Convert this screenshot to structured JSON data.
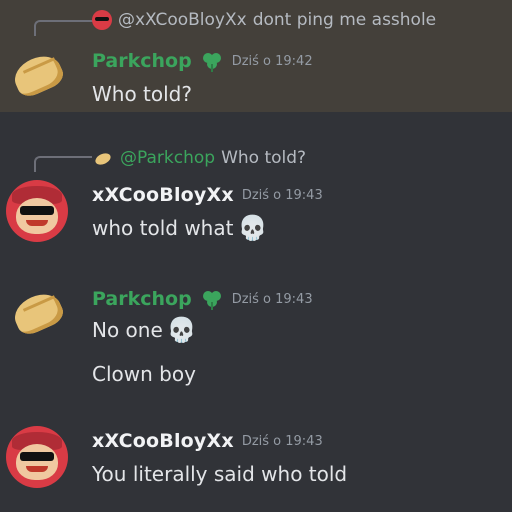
{
  "messages": [
    {
      "reply": {
        "author": "@xXCooBloyXx",
        "text": "dont ping me asshole"
      },
      "author": "Parkchop",
      "timestamp": "Dziś o 19:42",
      "lines": [
        "Who told?"
      ],
      "highlighted": true
    },
    {
      "reply": {
        "author": "@Parkchop",
        "text": "Who told?"
      },
      "author": "xXCooBloyXx",
      "timestamp": "Dziś o 19:43",
      "lines": [
        "who told what"
      ]
    },
    {
      "author": "Parkchop",
      "timestamp": "Dziś o 19:43",
      "lines": [
        "No one",
        "Clown boy"
      ]
    },
    {
      "author": "xXCooBloyXx",
      "timestamp": "Dziś o 19:43",
      "lines": [
        "You literally said who told"
      ]
    }
  ],
  "emoji": {
    "skull": "💀",
    "skull_icon": "skull-icon"
  },
  "colors": {
    "background": "#313338",
    "highlight": "#44403a",
    "green_name": "#3ba55d",
    "clown_red": "#d93b45"
  }
}
